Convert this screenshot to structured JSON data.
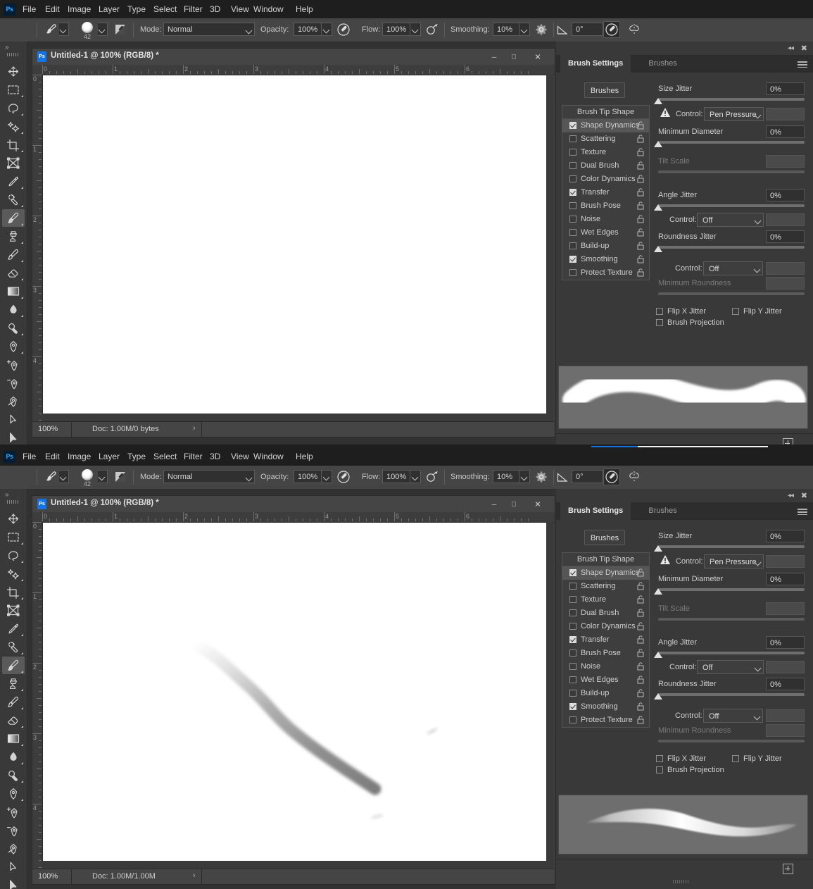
{
  "menu": {
    "logo": "Ps",
    "items": [
      "File",
      "Edit",
      "Image",
      "Layer",
      "Type",
      "Select",
      "Filter",
      "3D",
      "View",
      "Window",
      "Help"
    ]
  },
  "options_bar": {
    "home_icon": "home-icon",
    "brush_preset_icon": "brush-preset-icon",
    "brush_size": "42",
    "brush_panel_icon": "brush-panel-toggle-icon",
    "mode_label": "Mode:",
    "mode_value": "Normal",
    "opacity_label": "Opacity:",
    "opacity_value": "100%",
    "opacity_pressure_icon": "pressure-opacity-icon",
    "flow_label": "Flow:",
    "flow_value": "100%",
    "airbrush_icon": "airbrush-icon",
    "smoothing_label": "Smoothing:",
    "smoothing_value": "10%",
    "gear_icon": "smoothing-options-gear-icon",
    "angle_icon": "brush-angle-icon",
    "angle_value": "0°",
    "pressure_size_icon": "pressure-size-icon",
    "symmetry_icon": "symmetry-icon"
  },
  "toolbar": {
    "expand_icon": "expand-toolbar-icon",
    "tools": [
      {
        "name": "move-tool",
        "selected": false,
        "flyout": false
      },
      {
        "name": "rectangular-marquee-tool",
        "selected": false,
        "flyout": true
      },
      {
        "name": "lasso-tool",
        "selected": false,
        "flyout": true
      },
      {
        "name": "object-selection-tool",
        "selected": false,
        "flyout": true
      },
      {
        "name": "crop-tool",
        "selected": false,
        "flyout": true
      },
      {
        "name": "frame-tool",
        "selected": false,
        "flyout": false
      },
      {
        "name": "eyedropper-tool",
        "selected": false,
        "flyout": true
      },
      {
        "name": "spot-healing-brush-tool",
        "selected": false,
        "flyout": true
      },
      {
        "name": "brush-tool",
        "selected": true,
        "flyout": true
      },
      {
        "name": "clone-stamp-tool",
        "selected": false,
        "flyout": true
      },
      {
        "name": "history-brush-tool",
        "selected": false,
        "flyout": true
      },
      {
        "name": "eraser-tool",
        "selected": false,
        "flyout": true
      },
      {
        "name": "gradient-tool",
        "selected": false,
        "flyout": true
      },
      {
        "name": "blur-tool",
        "selected": false,
        "flyout": true
      },
      {
        "name": "dodge-tool",
        "selected": false,
        "flyout": true
      },
      {
        "name": "pen-tool",
        "selected": false,
        "flyout": true
      },
      {
        "name": "add-anchor-point-tool",
        "selected": false,
        "flyout": false
      },
      {
        "name": "delete-anchor-point-tool",
        "selected": false,
        "flyout": false
      },
      {
        "name": "convert-point-tool",
        "selected": false,
        "flyout": false
      },
      {
        "name": "path-selection-tool",
        "selected": false,
        "flyout": false
      },
      {
        "name": "direct-selection-tool",
        "selected": false,
        "flyout": false
      }
    ]
  },
  "windows": [
    {
      "title": "Untitled-1 @ 100% (RGB/8) *",
      "minimize": "—",
      "maximize": "▭",
      "close": "✕",
      "zoom": "100%",
      "doc_info": "Doc: 1.00M/0 bytes",
      "status_arrow": "›",
      "ruler_ticks": [
        "0",
        "1",
        "2",
        "3",
        "4",
        "5",
        "6"
      ],
      "ruler_v_ticks": [
        "0",
        "1",
        "2",
        "3",
        "4"
      ],
      "stroke": "none"
    },
    {
      "title": "Untitled-1 @ 100% (RGB/8) *",
      "minimize": "—",
      "maximize": "▭",
      "close": "✕",
      "zoom": "100%",
      "doc_info": "Doc: 1.00M/1.00M",
      "status_arrow": "›",
      "ruler_ticks": [
        "0",
        "1",
        "2",
        "3",
        "4",
        "5",
        "6"
      ],
      "ruler_v_ticks": [
        "0",
        "1",
        "2",
        "3",
        "4"
      ],
      "stroke": "tapered-diagonal-gray-brush-stroke"
    }
  ],
  "panel": {
    "collapse_icon": "collapse-panel-icon",
    "close_icon": "close-panel-icon",
    "menu_icon": "panel-menu-icon",
    "tabs": [
      {
        "label": "Brush Settings",
        "active": true
      },
      {
        "label": "Brushes",
        "active": false
      }
    ],
    "brushes_button": "Brushes",
    "list_header": "Brush Tip Shape",
    "list_items": [
      {
        "label": "Shape Dynamics",
        "checked": true,
        "selected": true
      },
      {
        "label": "Scattering",
        "checked": false,
        "selected": false
      },
      {
        "label": "Texture",
        "checked": false,
        "selected": false
      },
      {
        "label": "Dual Brush",
        "checked": false,
        "selected": false
      },
      {
        "label": "Color Dynamics",
        "checked": false,
        "selected": false
      },
      {
        "label": "Transfer",
        "checked": true,
        "selected": false
      },
      {
        "label": "Brush Pose",
        "checked": false,
        "selected": false
      },
      {
        "label": "Noise",
        "checked": false,
        "selected": false
      },
      {
        "label": "Wet Edges",
        "checked": false,
        "selected": false
      },
      {
        "label": "Build-up",
        "checked": false,
        "selected": false
      },
      {
        "label": "Smoothing",
        "checked": true,
        "selected": false
      },
      {
        "label": "Protect Texture",
        "checked": false,
        "selected": false
      }
    ],
    "controls": {
      "size_jitter_label": "Size Jitter",
      "size_jitter_value": "0%",
      "size_control_label": "Control:",
      "size_control_value": "Pen Pressure",
      "size_warning_icon": "warning-triangle-icon",
      "minimum_diameter_label": "Minimum Diameter",
      "minimum_diameter_value": "0%",
      "tilt_scale_label": "Tilt Scale",
      "tilt_scale_value": "",
      "angle_jitter_label": "Angle Jitter",
      "angle_jitter_value": "0%",
      "angle_control_label": "Control:",
      "angle_control_value": "Off",
      "roundness_jitter_label": "Roundness Jitter",
      "roundness_jitter_value": "0%",
      "roundness_control_label": "Control:",
      "roundness_control_value": "Off",
      "minimum_roundness_label": "Minimum Roundness",
      "minimum_roundness_value": "",
      "flip_x_label": "Flip X Jitter",
      "flip_y_label": "Flip Y Jitter",
      "brush_projection_label": "Brush Projection"
    },
    "previews": [
      {
        "style": "uniform-thick-s-stroke"
      },
      {
        "style": "tapered-s-stroke"
      }
    ],
    "new_brush_icon": "new-brush-preset-icon"
  },
  "colors": {
    "app_bg": "#323232",
    "menubar_bg": "#1e1e1e",
    "options_bg": "#454545",
    "panel_bg": "#393939",
    "accent_blue": "#1473e6",
    "canvas_white": "#ffffff",
    "preview_bg": "#6e6e6e",
    "selected_item": "#565656"
  }
}
